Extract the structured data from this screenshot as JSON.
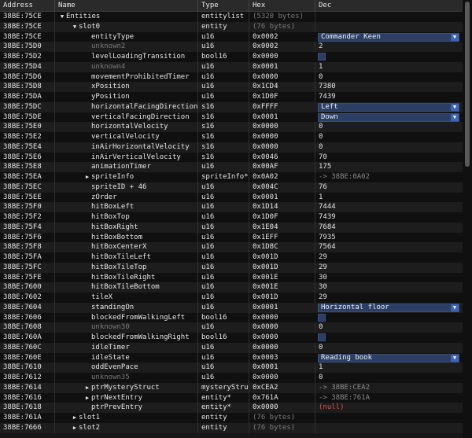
{
  "columns": {
    "address": "Address",
    "name": "Name",
    "type": "Type",
    "hex": "Hex",
    "dec": "Dec"
  },
  "rows": [
    {
      "addr": "38BE:75CE",
      "indent": 0,
      "arrow": "open",
      "name": "Entities",
      "type": "entitylist",
      "hex": "(5320 bytes)",
      "hex_style": "dim",
      "dec": ""
    },
    {
      "addr": "38BE:75CE",
      "indent": 1,
      "arrow": "open",
      "name": "slot0",
      "type": "entity",
      "hex": "(76 bytes)",
      "hex_style": "dim",
      "dec": ""
    },
    {
      "addr": "38BE:75CE",
      "indent": 2,
      "name": "entityType",
      "type": "u16",
      "hex": "0x0002",
      "widget": "combo",
      "dec": "Commander Keen"
    },
    {
      "addr": "38BE:75D0",
      "indent": 2,
      "name": "unknown2",
      "name_style": "dim",
      "type": "u16",
      "hex": "0x0002",
      "dec": "2"
    },
    {
      "addr": "38BE:75D2",
      "indent": 2,
      "name": "levelLoadingTransition",
      "type": "bool16",
      "hex": "0x0000",
      "widget": "check",
      "dec": ""
    },
    {
      "addr": "38BE:75D4",
      "indent": 2,
      "name": "unknown4",
      "name_style": "dim",
      "type": "u16",
      "hex": "0x0001",
      "dec": "1"
    },
    {
      "addr": "38BE:75D6",
      "indent": 2,
      "name": "movementProhibitedTimer",
      "type": "u16",
      "hex": "0x0000",
      "dec": "0"
    },
    {
      "addr": "38BE:75D8",
      "indent": 2,
      "name": "xPosition",
      "type": "u16",
      "hex": "0x1CD4",
      "dec": "7380"
    },
    {
      "addr": "38BE:75DA",
      "indent": 2,
      "name": "yPosition",
      "type": "u16",
      "hex": "0x1D0F",
      "dec": "7439"
    },
    {
      "addr": "38BE:75DC",
      "indent": 2,
      "name": "horizontalFacingDirection",
      "type": "s16",
      "hex": "0xFFFF",
      "widget": "combo",
      "dec": "Left"
    },
    {
      "addr": "38BE:75DE",
      "indent": 2,
      "name": "verticalFacingDirection",
      "type": "s16",
      "hex": "0x0001",
      "widget": "combo",
      "dec": "Down"
    },
    {
      "addr": "38BE:75E0",
      "indent": 2,
      "name": "horizontalVelocity",
      "type": "s16",
      "hex": "0x0000",
      "dec": "0"
    },
    {
      "addr": "38BE:75E2",
      "indent": 2,
      "name": "verticalVelocity",
      "type": "s16",
      "hex": "0x0000",
      "dec": "0"
    },
    {
      "addr": "38BE:75E4",
      "indent": 2,
      "name": "inAirHorizontalVelocity",
      "type": "s16",
      "hex": "0x0000",
      "dec": "0"
    },
    {
      "addr": "38BE:75E6",
      "indent": 2,
      "name": "inAirVerticalVelocity",
      "type": "s16",
      "hex": "0x0046",
      "dec": "70"
    },
    {
      "addr": "38BE:75E8",
      "indent": 2,
      "name": "animationTimer",
      "type": "u16",
      "hex": "0x00AF",
      "dec": "175"
    },
    {
      "addr": "38BE:75EA",
      "indent": 2,
      "arrow": "closed",
      "name": "spriteInfo",
      "type": "spriteInfo*",
      "hex": "0x0A02",
      "dec": "-> 38BE:0A02",
      "dec_style": "ptr"
    },
    {
      "addr": "38BE:75EC",
      "indent": 2,
      "name": "spriteID + 46",
      "type": "u16",
      "hex": "0x004C",
      "dec": "76"
    },
    {
      "addr": "38BE:75EE",
      "indent": 2,
      "name": "zOrder",
      "type": "u16",
      "hex": "0x0001",
      "dec": "1"
    },
    {
      "addr": "38BE:75F0",
      "indent": 2,
      "name": "hitBoxLeft",
      "type": "u16",
      "hex": "0x1D14",
      "dec": "7444"
    },
    {
      "addr": "38BE:75F2",
      "indent": 2,
      "name": "hitBoxTop",
      "type": "u16",
      "hex": "0x1D0F",
      "dec": "7439"
    },
    {
      "addr": "38BE:75F4",
      "indent": 2,
      "name": "hitBoxRight",
      "type": "u16",
      "hex": "0x1E04",
      "dec": "7684"
    },
    {
      "addr": "38BE:75F6",
      "indent": 2,
      "name": "hitBoxBottom",
      "type": "u16",
      "hex": "0x1EFF",
      "dec": "7935"
    },
    {
      "addr": "38BE:75F8",
      "indent": 2,
      "name": "hitBoxCenterX",
      "type": "u16",
      "hex": "0x1D8C",
      "dec": "7564"
    },
    {
      "addr": "38BE:75FA",
      "indent": 2,
      "name": "hitBoxTileLeft",
      "type": "u16",
      "hex": "0x001D",
      "dec": "29"
    },
    {
      "addr": "38BE:75FC",
      "indent": 2,
      "name": "hitBoxTileTop",
      "type": "u16",
      "hex": "0x001D",
      "dec": "29"
    },
    {
      "addr": "38BE:75FE",
      "indent": 2,
      "name": "hitBoxTileRight",
      "type": "u16",
      "hex": "0x001E",
      "dec": "30"
    },
    {
      "addr": "38BE:7600",
      "indent": 2,
      "name": "hitBoxTileBottom",
      "type": "u16",
      "hex": "0x001E",
      "dec": "30"
    },
    {
      "addr": "38BE:7602",
      "indent": 2,
      "name": "tileX",
      "type": "u16",
      "hex": "0x001D",
      "dec": "29"
    },
    {
      "addr": "38BE:7604",
      "indent": 2,
      "name": "standingOn",
      "type": "u16",
      "hex": "0x0001",
      "widget": "combo",
      "dec": "Horizontal floor"
    },
    {
      "addr": "38BE:7606",
      "indent": 2,
      "name": "blockedFromWalkingLeft",
      "type": "bool16",
      "hex": "0x0000",
      "widget": "check",
      "dec": ""
    },
    {
      "addr": "38BE:7608",
      "indent": 2,
      "name": "unknown30",
      "name_style": "dim",
      "type": "u16",
      "hex": "0x0000",
      "dec": "0"
    },
    {
      "addr": "38BE:760A",
      "indent": 2,
      "name": "blockedFromWalkingRight",
      "type": "bool16",
      "hex": "0x0000",
      "widget": "check",
      "dec": ""
    },
    {
      "addr": "38BE:760C",
      "indent": 2,
      "name": "idleTimer",
      "type": "u16",
      "hex": "0x0000",
      "dec": "0"
    },
    {
      "addr": "38BE:760E",
      "indent": 2,
      "name": "idleState",
      "type": "u16",
      "hex": "0x0003",
      "widget": "combo",
      "dec": "Reading book"
    },
    {
      "addr": "38BE:7610",
      "indent": 2,
      "name": "oddEvenPace",
      "type": "u16",
      "hex": "0x0001",
      "dec": "1"
    },
    {
      "addr": "38BE:7612",
      "indent": 2,
      "name": "unknown35",
      "name_style": "dim",
      "type": "u16",
      "hex": "0x0000",
      "dec": "0"
    },
    {
      "addr": "38BE:7614",
      "indent": 2,
      "arrow": "closed",
      "name": "ptrMysteryStruct",
      "type": "mysteryStruc",
      "hex": "0xCEA2",
      "dec": "-> 38BE:CEA2",
      "dec_style": "ptr"
    },
    {
      "addr": "38BE:7616",
      "indent": 2,
      "arrow": "closed",
      "name": "ptrNextEntry",
      "type": "entity*",
      "hex": "0x761A",
      "dec": "-> 38BE:761A",
      "dec_style": "ptr"
    },
    {
      "addr": "38BE:7618",
      "indent": 2,
      "name": "ptrPrevEntry",
      "type": "entity*",
      "hex": "0x0000",
      "dec": "(null)",
      "dec_style": "null"
    },
    {
      "addr": "38BE:761A",
      "indent": 1,
      "arrow": "closed",
      "name": "slot1",
      "type": "entity",
      "hex": "(76 bytes)",
      "hex_style": "dim",
      "dec": ""
    },
    {
      "addr": "38BE:7666",
      "indent": 1,
      "arrow": "closed",
      "name": "slot2",
      "type": "entity",
      "hex": "(76 bytes)",
      "hex_style": "dim",
      "dec": ""
    }
  ],
  "icons": {
    "open": "triangle-down-icon",
    "closed": "triangle-right-icon",
    "dropdown": "chevron-down-icon"
  }
}
